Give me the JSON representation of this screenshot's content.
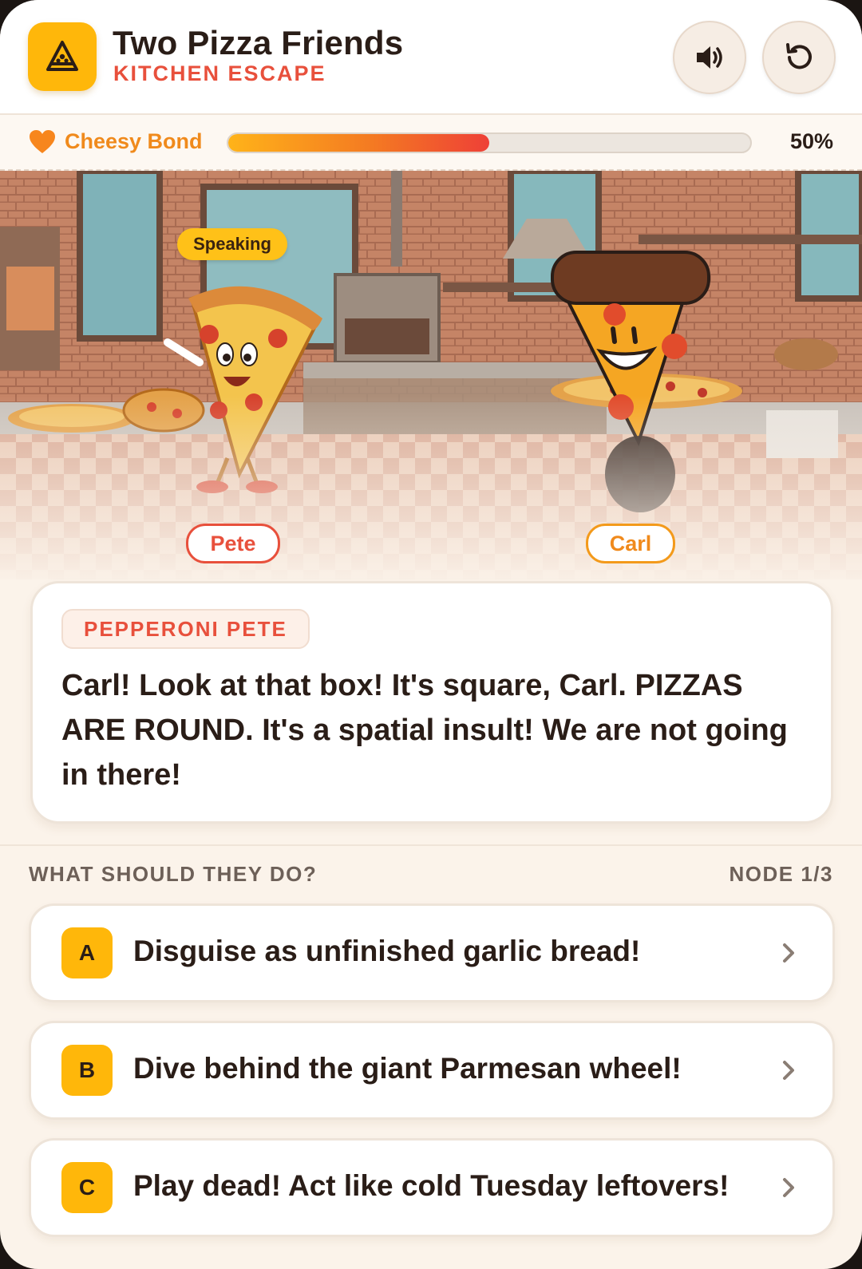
{
  "header": {
    "title": "Two Pizza Friends",
    "subtitle": "KITCHEN ESCAPE",
    "logo_icon": "pizza-slice-icon",
    "sound_icon": "speaker-icon",
    "restart_icon": "restart-icon"
  },
  "bond": {
    "label": "Cheesy Bond",
    "percent_label": "50%",
    "value": 0.5,
    "icon": "heart-icon"
  },
  "scene": {
    "speaking_badge": "Speaking",
    "characters": [
      {
        "tag": "Pete"
      },
      {
        "tag": "Carl"
      }
    ]
  },
  "dialogue": {
    "speaker": "PEPPERONI PETE",
    "text": "Carl! Look at that box! It's square, Carl. PIZZAS ARE ROUND. It's a spatial insult! We are not going in there!"
  },
  "choices_section": {
    "prompt": "WHAT SHOULD THEY DO?",
    "node": "NODE 1/3"
  },
  "choices": [
    {
      "letter": "A",
      "text": "Disguise as unfinished garlic bread!"
    },
    {
      "letter": "B",
      "text": "Dive behind the giant Parmesan wheel!"
    },
    {
      "letter": "C",
      "text": "Play dead! Act like cold Tuesday leftovers!"
    }
  ],
  "colors": {
    "accent_yellow": "#ffb70a",
    "accent_red": "#e8503c",
    "accent_orange": "#f08a1c",
    "background": "#fbf3ea"
  }
}
